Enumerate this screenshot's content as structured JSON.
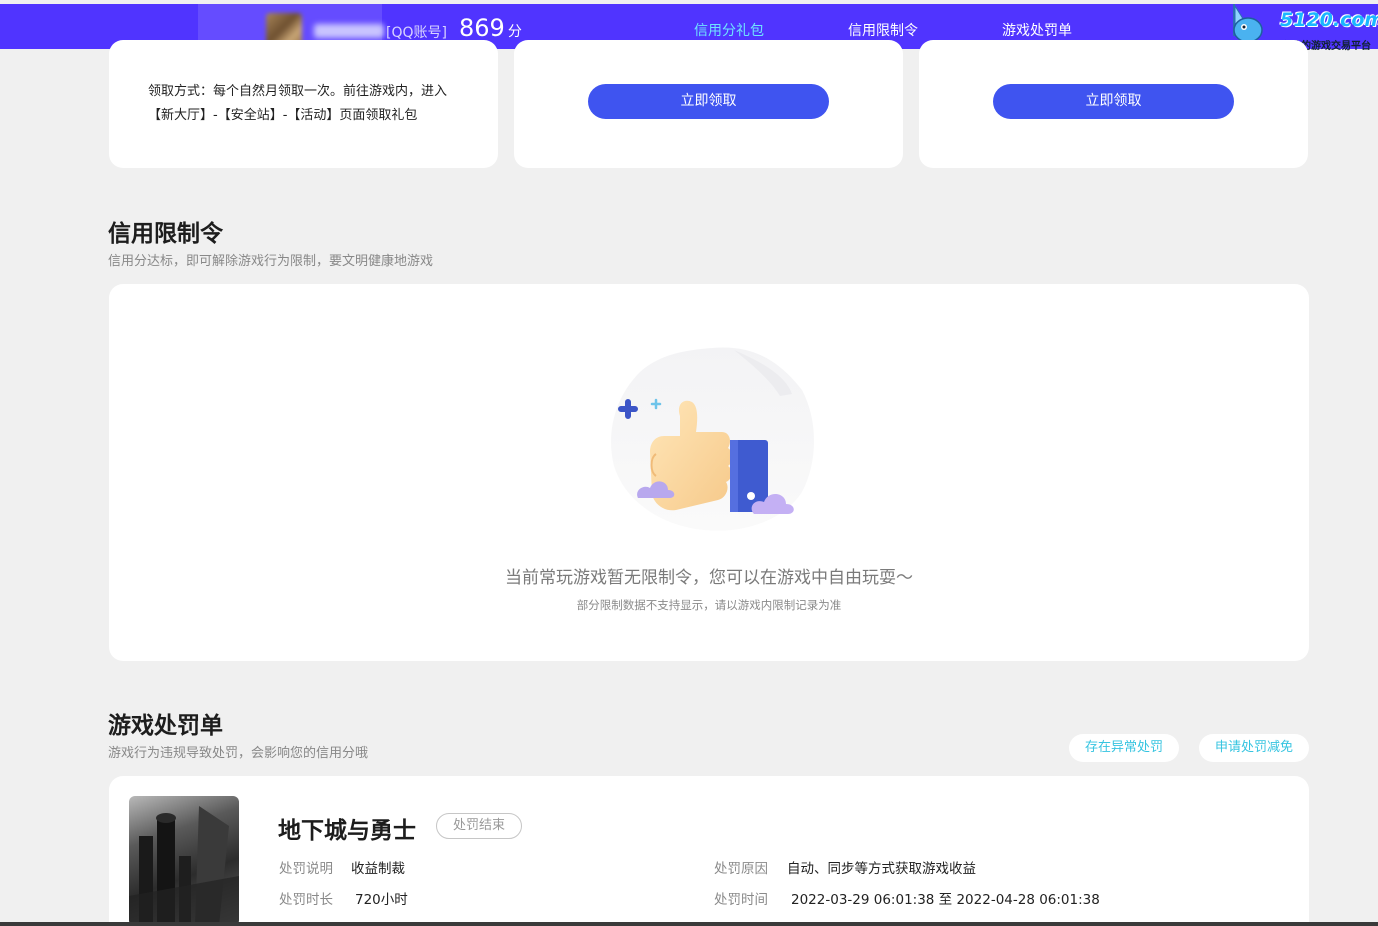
{
  "header": {
    "account_type": "[QQ账号]",
    "score": "869",
    "score_unit": "分",
    "tabs": [
      {
        "label": "信用分礼包",
        "active": true
      },
      {
        "label": "信用限制令",
        "active": false
      },
      {
        "label": "游戏处罚单",
        "active": false
      }
    ],
    "logo_text": "5120.com",
    "logo_slogan": "专业的游戏交易平台"
  },
  "gift_section": {
    "card1_desc": "领取方式：每个自然月领取一次。前往游戏内，进入【新大厅】-【安全站】-【活动】页面领取礼包",
    "card2_button": "立即领取",
    "card3_button": "立即领取"
  },
  "restriction": {
    "title": "信用限制令",
    "subtitle": "信用分达标，即可解除游戏行为限制，要文明健康地游戏",
    "empty_main": "当前常玩游戏暂无限制令，您可以在游戏中自由玩耍～",
    "empty_sub": "部分限制数据不支持显示，请以游戏内限制记录为准"
  },
  "penalty": {
    "title": "游戏处罚单",
    "subtitle": "游戏行为违规导致处罚，会影响您的信用分哦",
    "btn_abnormal": "存在异常处罚",
    "btn_reduce": "申请处罚减免",
    "game_name": "地下城与勇士",
    "status": "处罚结束",
    "desc_label": "处罚说明",
    "desc_value": "收益制裁",
    "duration_label": "处罚时长",
    "duration_value": "720小时",
    "reason_label": "处罚原因",
    "reason_value": "自动、同步等方式获取游戏收益",
    "time_label": "处罚时间",
    "time_value": "2022-03-29 06:01:38 至 2022-04-28 06:01:38"
  }
}
